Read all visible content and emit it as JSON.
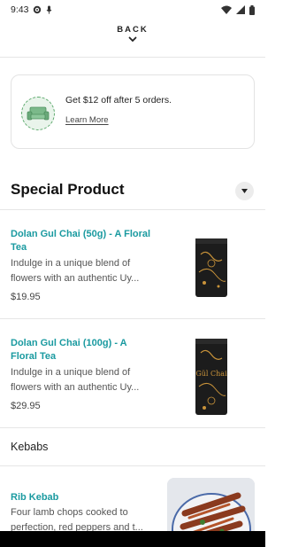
{
  "status_bar": {
    "time": "9:43"
  },
  "nav": {
    "back_label": "BACK"
  },
  "promo": {
    "text": "Get $12 off after 5 orders.",
    "link": "Learn More"
  },
  "section": {
    "title": "Special Product"
  },
  "products": [
    {
      "name": "Dolan Gul Chai (50g) - A Floral Tea",
      "description": "Indulge in a unique blend of flowers with an authentic Uy...",
      "price": "$19.95"
    },
    {
      "name": "Dolan Gul Chai (100g) - A Floral Tea",
      "description": "Indulge in a unique blend of flowers with an authentic Uy...",
      "price": "$29.95",
      "image_text": "Gül Chai"
    }
  ],
  "category": {
    "label": "Kebabs"
  },
  "kebab": {
    "name": "Rib Kebab",
    "description": "Four lamb chops cooked to perfection, red peppers and t..."
  },
  "colors": {
    "accent": "#1a9aa0",
    "promo_green": "#5aa86a"
  }
}
